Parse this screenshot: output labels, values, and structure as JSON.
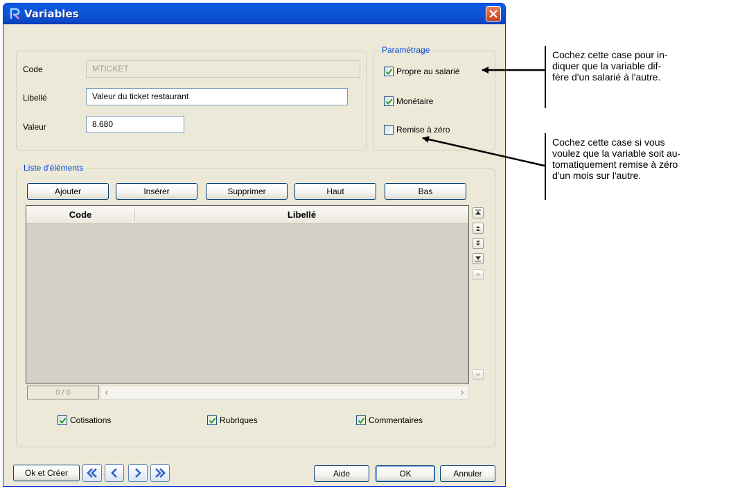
{
  "window": {
    "title": "Variables"
  },
  "fields": {
    "code_label": "Code",
    "code_value": "MTICKET",
    "libelle_label": "Libellé",
    "libelle_value": "Valeur du ticket restaurant",
    "valeur_label": "Valeur",
    "valeur_value": "8.680"
  },
  "parametrage": {
    "title": "Paramétrage",
    "options": [
      {
        "label": "Propre au salarié",
        "checked": true
      },
      {
        "label": "Monétaire",
        "checked": true
      },
      {
        "label": "Remise à zéro",
        "checked": false
      }
    ]
  },
  "liste": {
    "title": "Liste d'éléments",
    "buttons": [
      {
        "label": "Ajouter"
      },
      {
        "label": "Insérer"
      },
      {
        "label": "Supprimer"
      },
      {
        "label": "Haut"
      },
      {
        "label": "Bas"
      }
    ],
    "columns": [
      "Code",
      "Libellé"
    ],
    "counter": "0 / 0"
  },
  "bottom_checks": [
    {
      "label": "Cotisations",
      "checked": true
    },
    {
      "label": "Rubriques",
      "checked": true
    },
    {
      "label": "Commentaires",
      "checked": true
    }
  ],
  "footer": {
    "ok_create": "Ok et Créer",
    "aide": "Aide",
    "ok": "OK",
    "annuler": "Annuler"
  },
  "annotations": [
    {
      "lines": [
        "Cochez cette case pour in-",
        "diquer que la variable dif-",
        "fère d'un salarié à l'autre."
      ]
    },
    {
      "lines": [
        "Cochez cette case si vous",
        "voulez que la variable soit au-",
        "tomatiquement remise à zéro",
        "d'un mois sur l'autre."
      ]
    }
  ],
  "colors": {
    "titlebar": "#0a5ee6",
    "legend_text": "#0046d5",
    "dialog_bg": "#ece9d8",
    "check_green": "#21a121"
  }
}
